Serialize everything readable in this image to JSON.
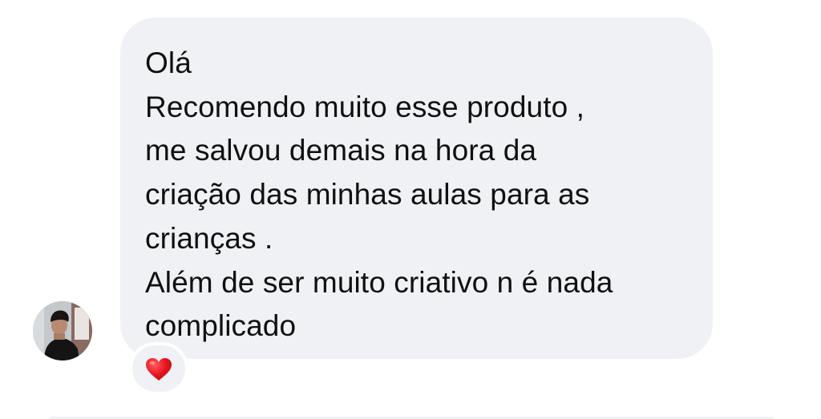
{
  "message": {
    "lines": [
      "Olá",
      "Recomendo muito esse produto ,",
      "me salvou demais na hora da",
      "criação das minhas aulas para as",
      "crianças .",
      "Além de ser muito criativo n é nada",
      "complicado"
    ]
  },
  "reaction": {
    "icon": "red-heart-icon",
    "color": "#e8141e"
  },
  "colors": {
    "bubble": "#eff1f4",
    "text": "#101010"
  }
}
